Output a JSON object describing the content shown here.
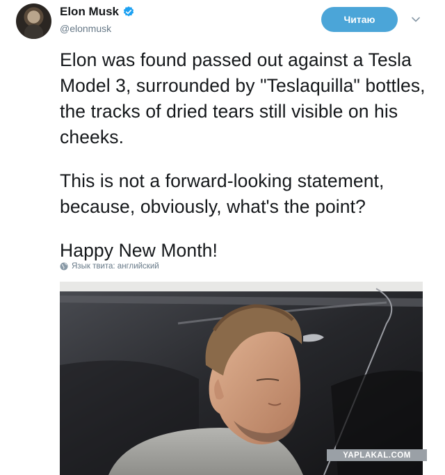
{
  "author": {
    "name": "Elon Musk",
    "handle": "@elonmusk"
  },
  "follow_button": {
    "label": "Читаю"
  },
  "tweet": {
    "paragraphs": [
      "Elon was found passed out against a Tesla Model 3, surrounded by \"Teslaquilla\" bottles, the tracks of dried tears still visible on his cheeks.",
      "This is not a forward-looking statement, because, obviously, what's the point?",
      "Happy New Month!"
    ],
    "language_note": "Язык твита: английский"
  },
  "watermark": "YAPLAKAL.COM",
  "colors": {
    "accent": "#4ba5d8",
    "verified": "#1da1f2",
    "text": "#14171a",
    "secondary": "#657786"
  },
  "icons": {
    "verified": "verified-badge-icon",
    "chevron": "chevron-down-icon",
    "globe": "globe-icon"
  }
}
